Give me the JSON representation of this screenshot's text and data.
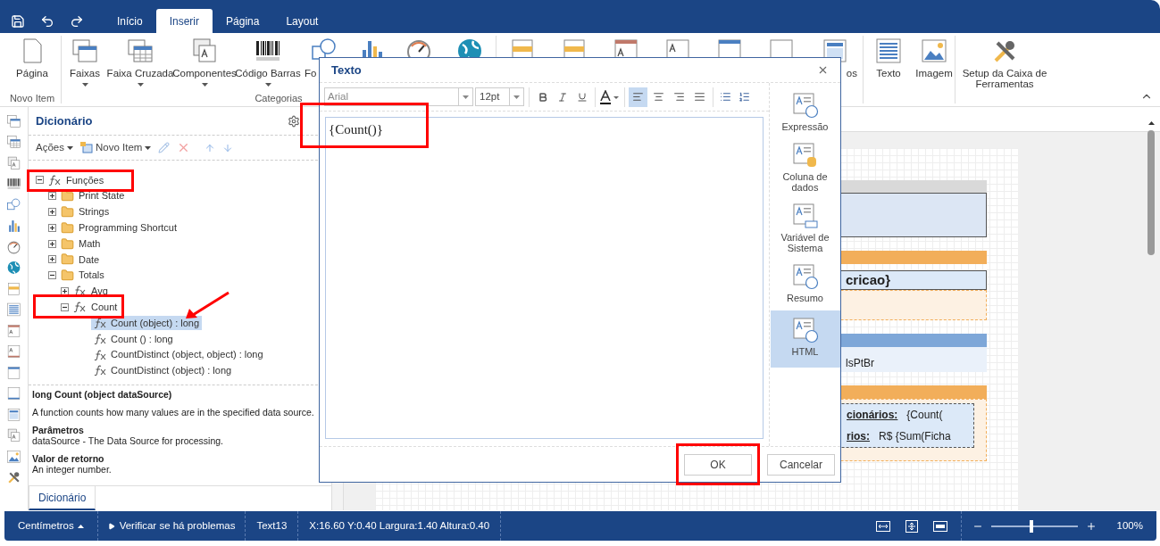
{
  "app_tabs": [
    {
      "label": "Início",
      "selected": false
    },
    {
      "label": "Inserir",
      "selected": true
    },
    {
      "label": "Página",
      "selected": false
    },
    {
      "label": "Layout",
      "selected": false
    }
  ],
  "ribbon": {
    "groups": [
      {
        "label": "Novo Item",
        "items": [
          {
            "label": "Página",
            "dropdown": false
          }
        ]
      },
      {
        "label": "Categorias",
        "items": [
          {
            "label": "Faixas",
            "dropdown": true
          },
          {
            "label": "Faixa Cruzada",
            "dropdown": true
          },
          {
            "label": "Componentes",
            "dropdown": true
          },
          {
            "label": "Código Barras",
            "dropdown": true
          },
          {
            "label": "Fo",
            "dropdown": false
          }
        ]
      },
      {
        "items": [
          {
            "label": "os",
            "dropdown": false
          }
        ]
      },
      {
        "items": [
          {
            "label": "Texto",
            "dropdown": false
          },
          {
            "label": "Imagem",
            "dropdown": false
          }
        ]
      },
      {
        "items": [
          {
            "label": "Setup da Caixa de Ferramentas",
            "dropdown": false
          }
        ]
      }
    ]
  },
  "dictionary": {
    "title": "Dicionário",
    "toolbar": [
      {
        "label": "Ações"
      },
      {
        "label": "Novo Item"
      }
    ],
    "tree": [
      {
        "label": "Funções",
        "kind": "function",
        "expanded": true,
        "children": [
          {
            "label": "Print State",
            "kind": "folder",
            "expanded": false
          },
          {
            "label": "Strings",
            "kind": "folder",
            "expanded": false
          },
          {
            "label": "Programming Shortcut",
            "kind": "folder",
            "expanded": false
          },
          {
            "label": "Math",
            "kind": "folder",
            "expanded": false
          },
          {
            "label": "Date",
            "kind": "folder",
            "expanded": false
          },
          {
            "label": "Totals",
            "kind": "folder",
            "expanded": true,
            "children": [
              {
                "label": "Avg",
                "kind": "function",
                "expanded": false
              },
              {
                "label": "Count",
                "kind": "function",
                "expanded": true,
                "leaves": [
                  {
                    "label": "Count (object) : long",
                    "selected": true
                  },
                  {
                    "label": "Count () : long",
                    "selected": false
                  },
                  {
                    "label": "CountDistinct (object, object) : long",
                    "selected": false
                  },
                  {
                    "label": "CountDistinct (object) : long",
                    "selected": false
                  }
                ]
              }
            ]
          }
        ]
      }
    ],
    "description": {
      "signature": "long Count (object dataSource)",
      "summary": "A function counts how many values are in the specified data source.",
      "sections": [
        {
          "heading": "Parâmetros",
          "text": "dataSource - The Data Source for processing."
        },
        {
          "heading": "Valor de retorno",
          "text": "An integer number."
        }
      ]
    },
    "bottom_tabs": [
      {
        "label": "Dicionário",
        "selected": true
      }
    ]
  },
  "report": {
    "group_header": "cricao}",
    "detail": "lsPtBr",
    "footer": [
      {
        "label": "cionários:",
        "value": "{Count("
      },
      {
        "label": "rios:",
        "value": "R$ {Sum(Ficha"
      }
    ]
  },
  "dialog": {
    "title": "Texto",
    "font": "Arial",
    "size": "12pt",
    "alignments": [
      {
        "selected": true
      },
      {
        "selected": false
      },
      {
        "selected": false
      },
      {
        "selected": false
      }
    ],
    "content": "{Count()}",
    "modes": [
      {
        "label": "Expressão",
        "selected": false
      },
      {
        "label": "Coluna de dados",
        "selected": false
      },
      {
        "label": "Variável de Sistema",
        "selected": false
      },
      {
        "label": "Resumo",
        "selected": false
      },
      {
        "label": "HTML",
        "selected": true
      }
    ],
    "buttons": [
      "OK",
      "Cancelar"
    ]
  },
  "status_bar": {
    "units": "Centímetros",
    "check": "Verificar se há problemas",
    "component": "Text13",
    "position": "X:16.60 Y:0.40 Largura:1.40 Altura:0.40",
    "zoom": {
      "level": 0.47,
      "reading": "100%"
    }
  }
}
